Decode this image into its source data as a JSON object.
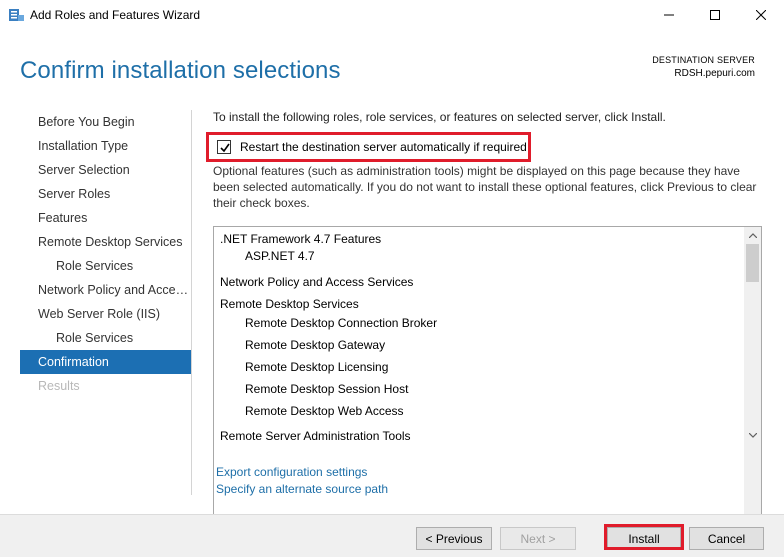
{
  "window": {
    "title": "Add Roles and Features Wizard"
  },
  "header": {
    "page_title": "Confirm installation selections",
    "destination_label": "DESTINATION SERVER",
    "destination_server": "RDSH.pepuri.com"
  },
  "nav": {
    "items": [
      {
        "label": "Before You Begin",
        "state": "normal"
      },
      {
        "label": "Installation Type",
        "state": "normal"
      },
      {
        "label": "Server Selection",
        "state": "normal"
      },
      {
        "label": "Server Roles",
        "state": "normal"
      },
      {
        "label": "Features",
        "state": "normal"
      },
      {
        "label": "Remote Desktop Services",
        "state": "normal"
      },
      {
        "label": "Role Services",
        "state": "sub"
      },
      {
        "label": "Network Policy and Acces...",
        "state": "normal"
      },
      {
        "label": "Web Server Role (IIS)",
        "state": "normal"
      },
      {
        "label": "Role Services",
        "state": "sub"
      },
      {
        "label": "Confirmation",
        "state": "active"
      },
      {
        "label": "Results",
        "state": "disabled"
      }
    ]
  },
  "main": {
    "intro": "To install the following roles, role services, or features on selected server, click Install.",
    "restart_checkbox": {
      "label": "Restart the destination server automatically if required",
      "checked": true
    },
    "optional_text": "Optional features (such as administration tools) might be displayed on this page because they have been selected automatically. If you do not want to install these optional features, click Previous to clear their check boxes.",
    "features": [
      {
        "label": ".NET Framework 4.7 Features",
        "level": 0
      },
      {
        "label": "ASP.NET 4.7",
        "level": 1
      },
      {
        "label": "Network Policy and Access Services",
        "level": 0
      },
      {
        "label": "Remote Desktop Services",
        "level": 0
      },
      {
        "label": "Remote Desktop Connection Broker",
        "level": 1
      },
      {
        "label": "Remote Desktop Gateway",
        "level": 1
      },
      {
        "label": "Remote Desktop Licensing",
        "level": 1
      },
      {
        "label": "Remote Desktop Session Host",
        "level": 1
      },
      {
        "label": "Remote Desktop Web Access",
        "level": 1
      },
      {
        "label": "Remote Server Administration Tools",
        "level": 0
      }
    ],
    "links": {
      "export": "Export configuration settings",
      "alternate_source": "Specify an alternate source path"
    }
  },
  "footer": {
    "previous_label": "< Previous",
    "next_label": "Next >",
    "install_label": "Install",
    "cancel_label": "Cancel"
  },
  "colors": {
    "accent": "#1c6fb3",
    "title_blue": "#1e6fa8",
    "highlight_red": "#e01c2b"
  }
}
